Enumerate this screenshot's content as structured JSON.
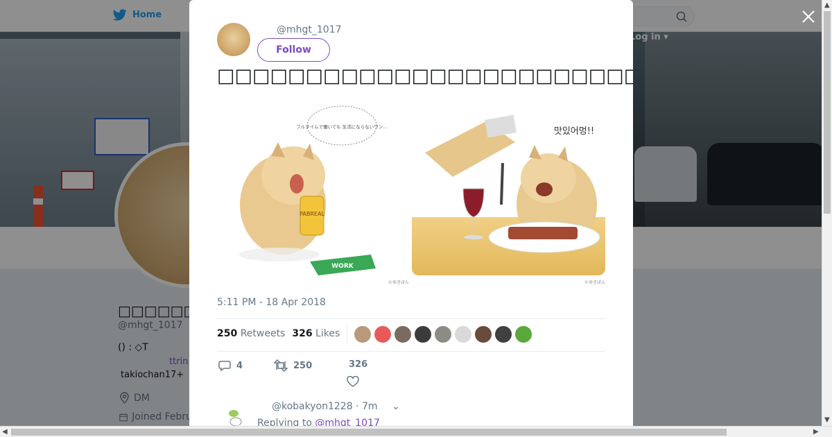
{
  "nav": {
    "home_label": "Home",
    "login_label": "Log in"
  },
  "profile": {
    "name": "\u0000\u0000\u0000\u0000\u0000\u0000\u0000\u0000\u0000\u0000",
    "name_glyphs": "□□□□□□□□□□",
    "handle": "@mhgt_1017",
    "bio": "() : ◇T",
    "link": "ttrin",
    "extra": "takiochan17+",
    "location": "DM",
    "joined": "Joined Febru"
  },
  "tweet": {
    "handle": "@mhgt_1017",
    "follow_label": "Follow",
    "text": "□□□□□□□□□□□□□□□□□□□□□□□□□□□□□□□□□□□□□□□□□□□□A□□□□□□□□□□□□□□□□□□□□□□□□□□",
    "image": {
      "thought_bubble": "フルタイムで働いても 生活にならないワン…",
      "can_label": "PABREAL",
      "book_label": "WORK",
      "speech_text": "맛있어멍!!",
      "signature": "©ゆきぼん"
    },
    "timestamp": "5:11 PM - 18 Apr 2018",
    "retweets_count": "250",
    "retweets_label": "Retweets",
    "likes_count": "326",
    "likes_label": "Likes",
    "liker_colors": [
      "#b89a7a",
      "#e85a5a",
      "#7a6b60",
      "#3b3b3b",
      "#8c8c84",
      "#d9d9d9",
      "#6a4a3a",
      "#404040",
      "#5aa83c"
    ],
    "reply_count": "4",
    "retweet_action_count": "250",
    "like_action_count": "326"
  },
  "reply": {
    "handle": "@kobakyon1228",
    "time": "· 7m",
    "replying_prefix": "Replying to",
    "replying_to": "@mhgt_1017"
  }
}
